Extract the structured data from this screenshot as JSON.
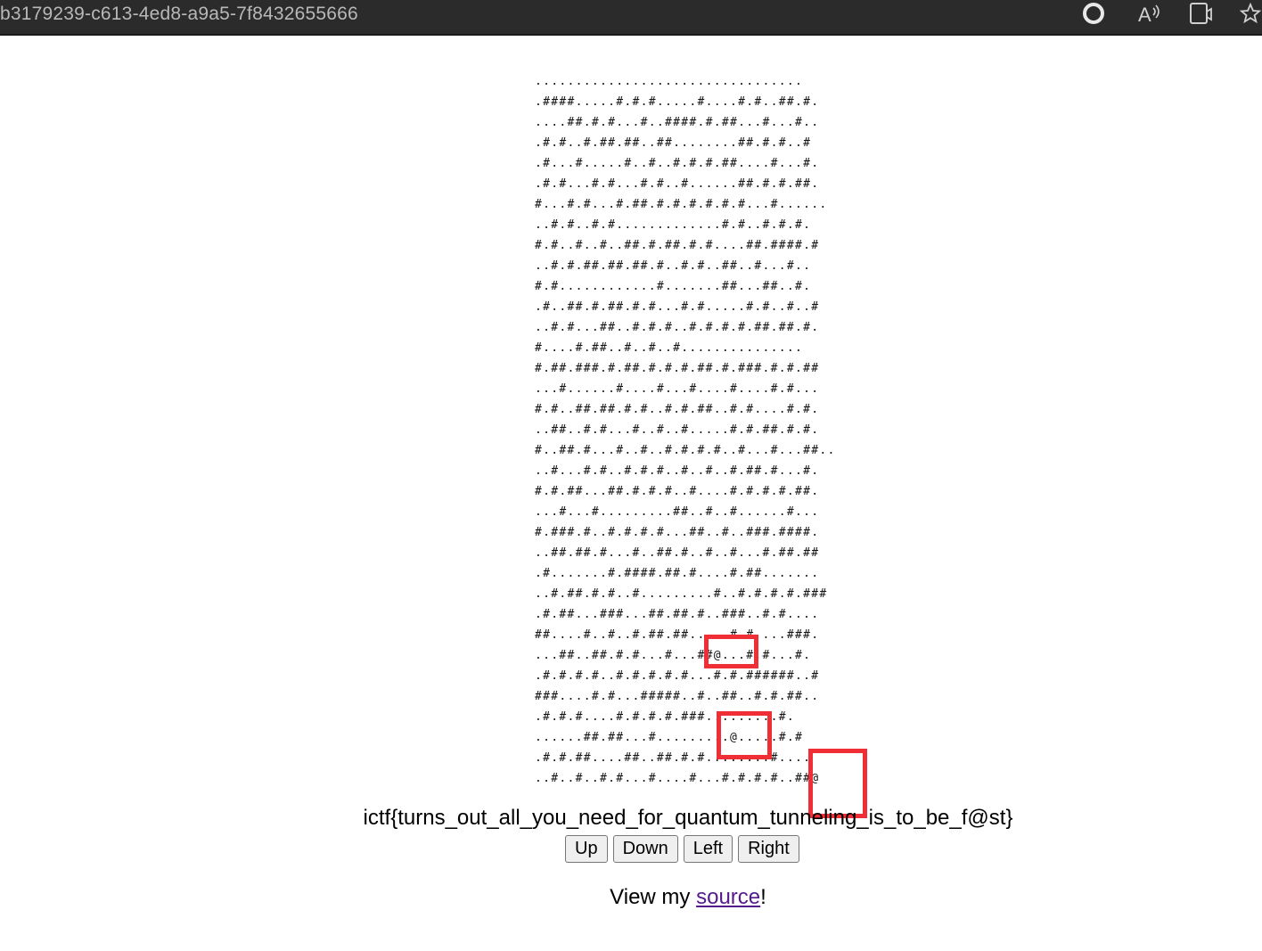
{
  "browser": {
    "url_fragment": "b3179239-c613-4ed8-a9a5-7f8432655666",
    "icons": [
      "edge-refresh-icon",
      "read-aloud-icon",
      "immersive-reader-icon",
      "favorite-star-icon"
    ]
  },
  "maze": {
    "lines": [
      ".................................",
      ".####.....#.#.#.....#....#.#..##.#.",
      "....##.#.#...#..####.#.##...#...#..",
      ".#.#..#.##.##..##........##.#.#..#",
      ".#...#.....#..#..#.#.#.##....#...#.",
      ".#.#...#.#...#.#..#......##.#.#.##.",
      "#...#.#...#.##.#.#.#.#.#.#...#......",
      "..#.#..#.#.............#.#..#.#.#.",
      "#.#..#..#..##.#.##.#.#....##.####.#",
      "..#.#.##.##.##.#..#.#..##..#...#..",
      "#.#............#.......##...##..#.",
      ".#..##.#.##.#.#...#.#.....#.#..#..#",
      "..#.#...##..#.#.#..#.#.#.#.##.##.#.",
      "#....#.##..#..#..#...............",
      "#.##.###.#.##.#.#.#.##.#.###.#.#.##",
      "...#......#....#...#....#....#.#...",
      "#.#..##.##.#.#..#.#.##..#.#....#.#.",
      "..##..#.#...#..#..#.....#.#.##.#.#.",
      "#..##.#...#..#..#.#.#.#..#...#...##..",
      "..#...#.#..#.#.#..#..#..#.##.#...#.",
      "#.#.##...##.#.#.#..#....#.#.#.#.##.",
      "...#...#.........##..#..#......#...",
      "#.###.#..#.#.#.#...##..#..###.####.",
      "..##.##.#...#..##.#..#..#...#.##.##",
      ".#.......#.####.##.#....#.##.......",
      "..#.##.#.#..#.........#..#.#.#.#.###",
      ".#.##...###...##.##.#..###..#.#....",
      "##....#..#..#.##.##.....#.#....###.",
      "...##..##.#.#...#...##@...#.#...#.",
      ".#.#.#.#..#.#.#.#.#...#.#.######..#",
      "###....#.#...#####..#..##..#.#.##..",
      ".#.#.#....#.#.#.#.###.........#.",
      "......##.##...#.........@.....#.#",
      ".#.#.##....##..##.#.#........#....",
      "..#..#..#.#...#....#...#.#.#.#..##@"
    ]
  },
  "flag_text": "ictf{turns_out_all_you_need_for_quantum_tunneling_is_to_be_f@st}",
  "controls": {
    "up": "Up",
    "down": "Down",
    "left": "Left",
    "right": "Right"
  },
  "footer": {
    "prefix": "View my ",
    "link": "source",
    "suffix": "!"
  },
  "colors": {
    "highlight": "#ef2f35",
    "link": "#551a8b"
  }
}
